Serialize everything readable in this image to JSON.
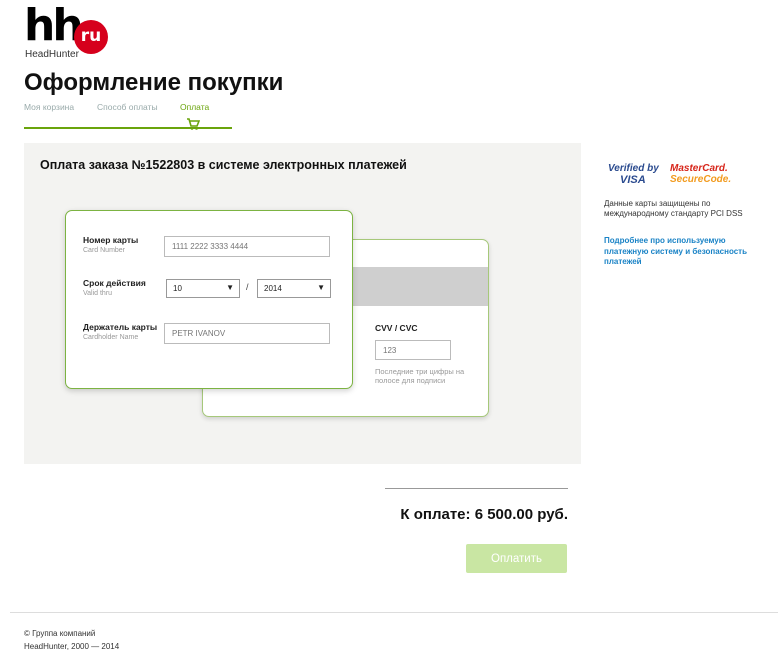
{
  "logo": {
    "mark": "hh",
    "badge": "ru",
    "name": "HeadHunter"
  },
  "page_title": "Оформление покупки",
  "steps": [
    {
      "label": "Моя корзина"
    },
    {
      "label": "Способ оплаты"
    },
    {
      "label": "Оплата"
    }
  ],
  "colors": {
    "accent": "#7cb342",
    "brand_red": "#d6001c",
    "link": "#1a83c6",
    "pay_button": "#c9e6a3"
  },
  "payment": {
    "title": "Оплата заказа №1522803 в системе электронных платежей",
    "card_number_label": "Номер карты",
    "card_number_sublabel": "Card Number",
    "card_number_placeholder": "1111 2222 3333 4444",
    "expiry_label": "Срок действия",
    "expiry_sublabel": "Valid thru",
    "expiry_month": "10",
    "expiry_separator": "/",
    "expiry_year": "2014",
    "holder_label": "Держатель карты",
    "holder_sublabel": "Cardholder Name",
    "holder_placeholder": "PETR IVANOV",
    "cvv_label": "CVV / CVC",
    "cvv_placeholder": "123",
    "cvv_hint": "Последние три цифры на полосе для подписи"
  },
  "security": {
    "verified_line1": "Verified by",
    "verified_line2": "VISA",
    "mastercard_line1": "MasterCard.",
    "mastercard_line2": "SecureCode.",
    "pci_text": "Данные карты защищены по международному стандарту PCI DSS",
    "info_link": "Подробнее про используемую платежную систему и безопасность платежей"
  },
  "total": {
    "text": "К оплате: 6 500.00 руб."
  },
  "pay_button": "Оплатить",
  "footer": {
    "line1": "© Группа компаний",
    "line2": "HeadHunter, 2000 — 2014"
  }
}
